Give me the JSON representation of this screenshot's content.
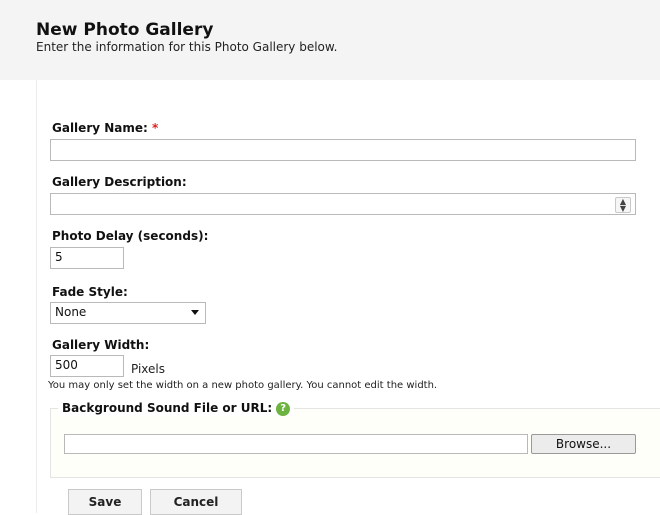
{
  "header": {
    "title": "New Photo Gallery",
    "subtitle": "Enter the information for this Photo Gallery below."
  },
  "form": {
    "gallery_name": {
      "label": "Gallery Name:",
      "required_mark": "*",
      "value": ""
    },
    "gallery_description": {
      "label": "Gallery Description:",
      "value": ""
    },
    "photo_delay": {
      "label": "Photo Delay (seconds):",
      "value": "5"
    },
    "fade_style": {
      "label": "Fade Style:",
      "selected": "None"
    },
    "gallery_width": {
      "label": "Gallery Width:",
      "value": "500",
      "unit": "Pixels",
      "note": "You may only set the width on a new photo gallery. You cannot edit the width."
    },
    "background_sound": {
      "legend": "Background Sound File or URL:",
      "help_icon": "question-circle-icon",
      "value": "",
      "browse_label": "Browse..."
    }
  },
  "buttons": {
    "save": "Save",
    "cancel": "Cancel"
  },
  "colors": {
    "required": "#e02020",
    "help_icon": "#6db33f",
    "header_bg": "#f4f4f4"
  }
}
